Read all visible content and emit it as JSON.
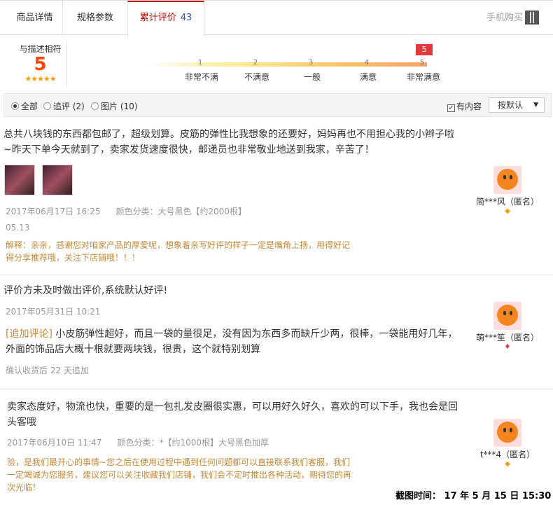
{
  "tabs": {
    "details": "商品详情",
    "specs": "规格参数",
    "reviews": "累计评价",
    "reviews_count": "43",
    "mobile": "手机购买"
  },
  "rating": {
    "label": "与描述相符",
    "score": "5",
    "stars": "★★★★★",
    "marker": "5",
    "ticks": [
      "1",
      "2",
      "3",
      "4",
      "5"
    ],
    "levels": [
      "非常不满",
      "不满意",
      "一般",
      "满意",
      "非常满意"
    ]
  },
  "filter": {
    "all": "全部",
    "followup": "追评 (2)",
    "pictures": "图片 (10)",
    "has_content": "有内容",
    "sort": "按默认"
  },
  "reviews": [
    {
      "text": "总共八块钱的东西都包邮了，超级划算。皮筋的弹性比我想象的还要好，妈妈再也不用担心我的小辫子啦~昨天下单今天就到了，卖家发货速度很快，邮递员也非常敬业地送到我家，辛苦了！",
      "date": "2017年06月17日 16:25",
      "sku": "颜色分类：大号黑色【约2000根】",
      "reply_date": "05.13",
      "reply": "解释：亲亲，感谢您对咱家产品的厚爱呢，想象着亲写好评的样子一定是嘴角上扬，用得好记得分享推荐哦，关注下店铺哦！！！",
      "user": "简***风（匿名）"
    },
    {
      "text": "评价方未及时做出评价,系统默认好评!",
      "date": "2017年05月31日 10:21",
      "followup_label": "[追加评论]",
      "followup": "小皮筋弹性超好，而且一袋的量很足，没有因为东西多而缺斤少两，很棒，一袋能用好几年，外面的饰品店大概十根就要两块钱，很贵，这个就特别划算",
      "followup_meta": "确认收货后 22 天追加",
      "user": "萌***笙（匿名）"
    },
    {
      "text": "卖家态度好，物流也快，重要的是一包扎发皮圈很实惠，可以用好久好久，喜欢的可以下手，我也会是回头客哦",
      "date": "2017年06月10日 11:47",
      "sku": "颜色分类：*【约1000根】大号黑色加厚",
      "reply": "验，是我们最开心的事情~您之后在使用过程中遇到任何问题都可以直接联系我们客服，我们一定竭诚为您服务，建议您可以关注收藏我们店铺，我们会不定时推出各种活动，期待您的再次光临！",
      "user": "t***4（匿名）"
    }
  ],
  "vip": "◆",
  "vip2": "♦",
  "screenshot_time": "截图时间：  17 年 5 月 15 日 15:30"
}
